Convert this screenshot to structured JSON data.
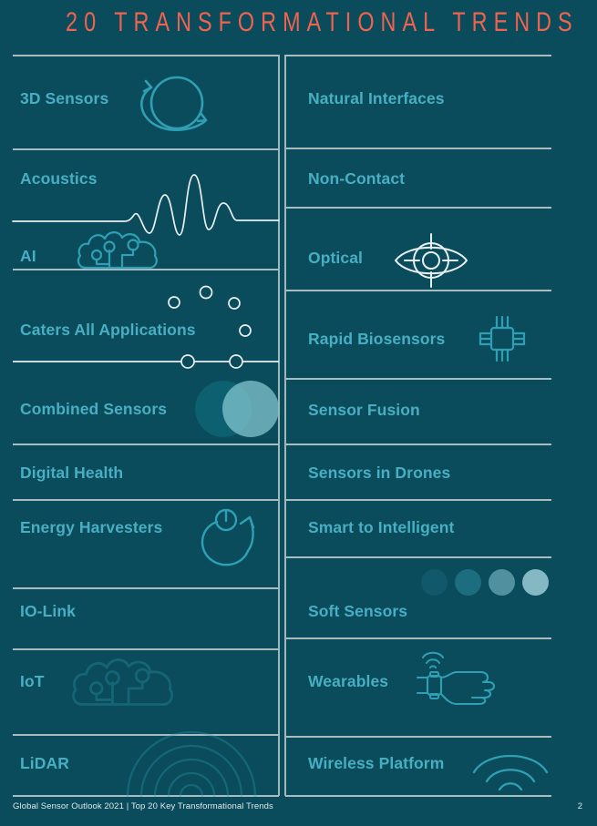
{
  "header": {
    "title": "20 TRANSFORMATIONAL TRENDS",
    "title_color": "#f0634f"
  },
  "theme": {
    "background": "#0a4c5c",
    "label_color": "#48aec2",
    "divider_color": "#a9bcc0",
    "icon_teal": "#2f9fb4",
    "icon_white": "#e8eff1",
    "footer_color": "#dfe9ec"
  },
  "columns": {
    "left": {
      "rows": [
        {
          "label": "3D Sensors",
          "icon": "orbit-sphere-icon"
        },
        {
          "label": "Acoustics",
          "icon": "waveform-icon"
        },
        {
          "label": "AI",
          "icon": "cloud-circuit-brain-icon"
        },
        {
          "label": "Caters All Applications",
          "icon": "scatter-nodes-icon"
        },
        {
          "label": "Combined Sensors",
          "icon": "overlapping-circles-icon"
        },
        {
          "label": "Digital Health",
          "icon": "none"
        },
        {
          "label": "Energy Harvesters",
          "icon": "power-recycle-icon"
        },
        {
          "label": "IO-Link",
          "icon": "none"
        },
        {
          "label": "IoT",
          "icon": "cloud-circuit-brain-faded-icon"
        },
        {
          "label": "LiDAR",
          "icon": "concentric-arcs-icon"
        }
      ]
    },
    "right": {
      "rows": [
        {
          "label": "Natural Interfaces",
          "icon": "none"
        },
        {
          "label": "Non-Contact",
          "icon": "none"
        },
        {
          "label": "Optical",
          "icon": "eye-target-icon"
        },
        {
          "label": "Rapid Biosensors",
          "icon": "chip-icon"
        },
        {
          "label": "Sensor Fusion",
          "icon": "none"
        },
        {
          "label": "Sensors in Drones",
          "icon": "none"
        },
        {
          "label": "Smart to Intelligent",
          "icon": "none"
        },
        {
          "label": "Soft Sensors",
          "icon": "gradient-dots-icon"
        },
        {
          "label": "Wearables",
          "icon": "smartwatch-fist-icon"
        },
        {
          "label": "Wireless Platform",
          "icon": "wifi-arcs-icon"
        }
      ]
    }
  },
  "footer": {
    "text": "Global Sensor Outlook 2021  |  Top 20 Key Transformational Trends",
    "page_number": "2"
  }
}
